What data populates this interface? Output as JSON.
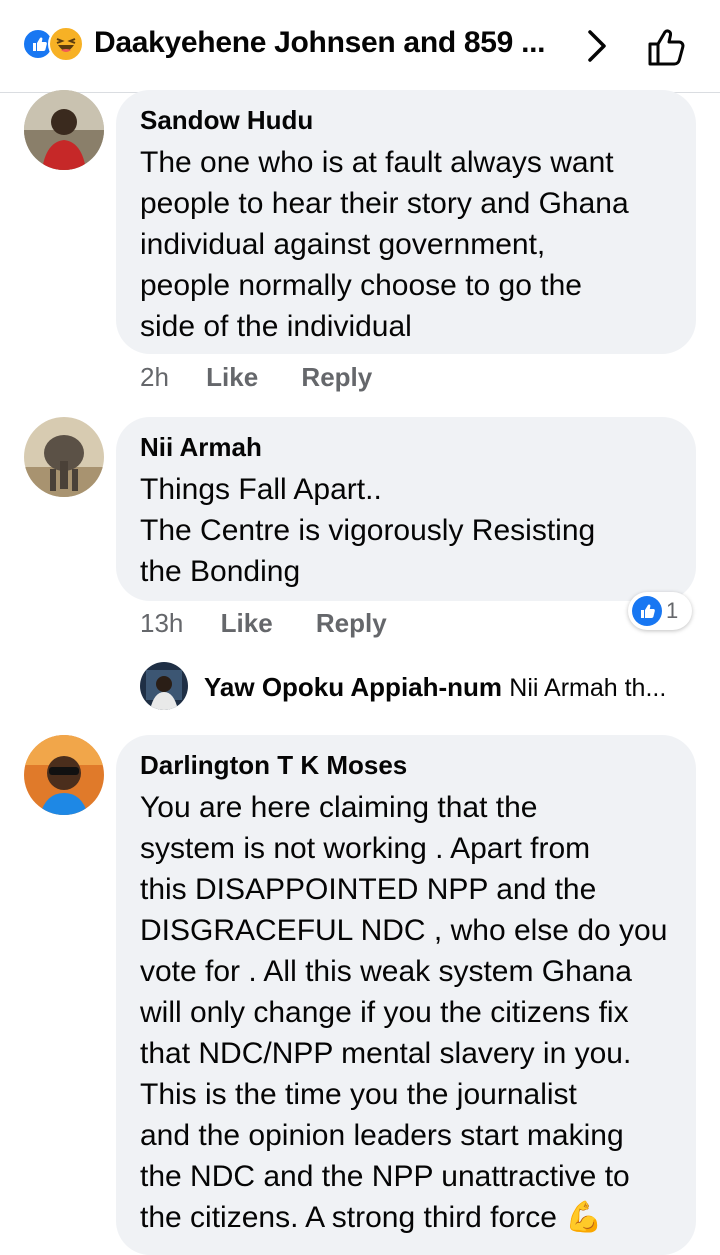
{
  "header": {
    "title": "Daakyehene Johnsen and 859 ...",
    "reaction_icons": [
      "like-icon",
      "haha-icon"
    ],
    "accent": "#1877f2"
  },
  "comments": [
    {
      "author": "Sandow Hudu",
      "text": "The one who is at fault always want\npeople to hear their story and Ghana\nindividual against government,\npeople normally choose to go the\nside of the individual",
      "time": "2h",
      "like_label": "Like",
      "reply_label": "Reply"
    },
    {
      "author": "Nii Armah",
      "text": "Things Fall Apart..\nThe Centre is vigorously  Resisting\nthe Bonding",
      "time": "13h",
      "like_label": "Like",
      "reply_label": "Reply",
      "reaction_count": "1",
      "reply_preview": {
        "author": "Yaw Opoku Appiah-num",
        "snippet": "Nii Armah th..."
      }
    },
    {
      "author": "Darlington T K Moses",
      "text": "You are here claiming that the\nsystem is not working . Apart from\nthis DISAPPOINTED NPP and the\nDISGRACEFUL NDC , who else do you\nvote for . All this weak system Ghana\nwill only change if you the citizens fix\nthat NDC/NPP mental slavery in you.\nThis is the  time you the journalist\nand the opinion leaders start making\nthe NDC and the NPP unattractive to\nthe citizens. A strong third force 💪"
    }
  ]
}
